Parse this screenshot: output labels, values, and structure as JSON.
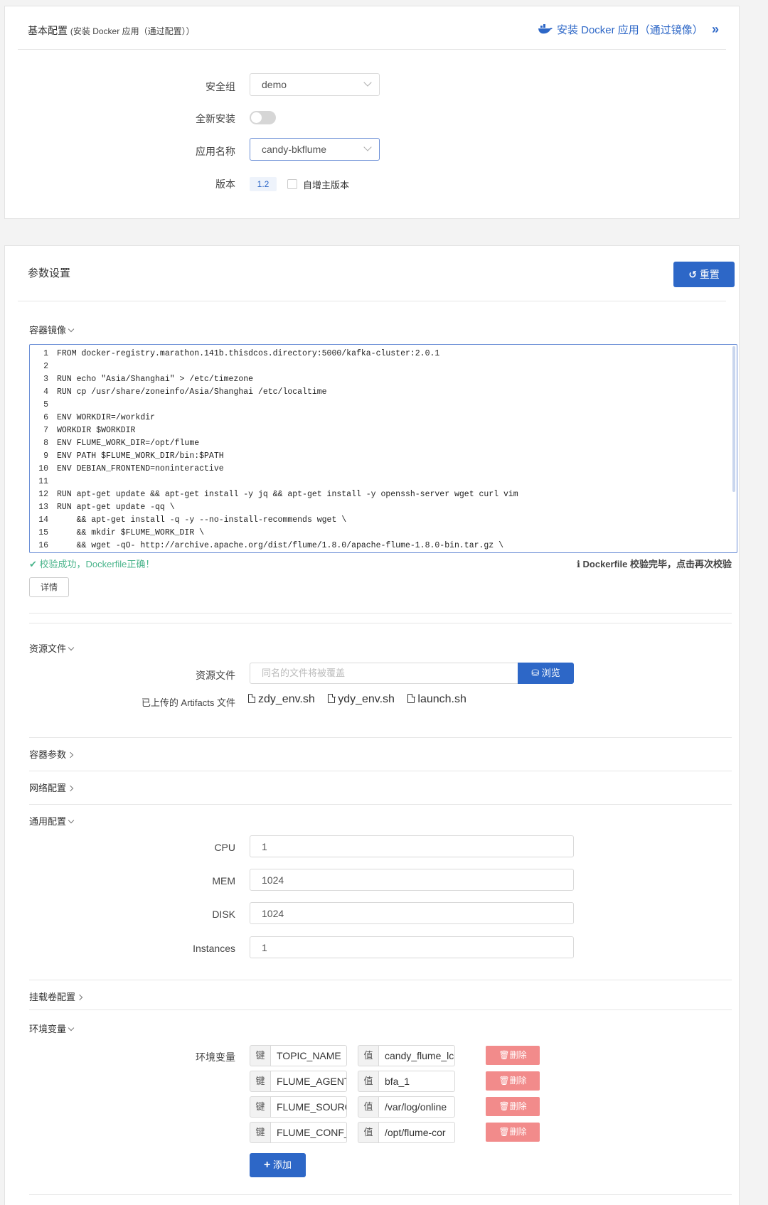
{
  "basic": {
    "title": "基本配置",
    "subtitle": "(安装 Docker 应用（通过配置））",
    "install_link": "安装 Docker 应用（通过镜像）",
    "install_arrow": "»",
    "security_group_label": "安全组",
    "security_group_value": "demo",
    "fresh_install_label": "全新安装",
    "fresh_install_on": false,
    "app_name_label": "应用名称",
    "app_name_value": "candy-bkflume",
    "version_label": "版本",
    "version_value": "1.2",
    "auto_increment_label": "自增主版本"
  },
  "params": {
    "title": "参数设置",
    "reset_label": "重置",
    "image_section": "容器镜像",
    "code_lines": [
      {
        "n": "1",
        "text": "FROM docker-registry.marathon.141b.thisdcos.directory:5000/kafka-cluster:2.0.1"
      },
      {
        "n": "2",
        "text": ""
      },
      {
        "n": "3",
        "text": "RUN echo \"Asia/Shanghai\" > /etc/timezone"
      },
      {
        "n": "4",
        "text": "RUN cp /usr/share/zoneinfo/Asia/Shanghai /etc/localtime"
      },
      {
        "n": "5",
        "text": ""
      },
      {
        "n": "6",
        "text": "ENV WORKDIR=/workdir"
      },
      {
        "n": "7",
        "text": "WORKDIR $WORKDIR"
      },
      {
        "n": "8",
        "text": "ENV FLUME_WORK_DIR=/opt/flume"
      },
      {
        "n": "9",
        "text": "ENV PATH $FLUME_WORK_DIR/bin:$PATH"
      },
      {
        "n": "10",
        "text": "ENV DEBIAN_FRONTEND=noninteractive"
      },
      {
        "n": "11",
        "text": ""
      },
      {
        "n": "12",
        "text": "RUN apt-get update && apt-get install -y jq && apt-get install -y openssh-server wget curl vim"
      },
      {
        "n": "13",
        "text": "RUN apt-get update -qq \\"
      },
      {
        "n": "14",
        "text": "    && apt-get install -q -y --no-install-recommends wget \\"
      },
      {
        "n": "15",
        "text": "    && mkdir $FLUME_WORK_DIR \\"
      },
      {
        "n": "16",
        "text": "    && wget -qO- http://archive.apache.org/dist/flume/1.8.0/apache-flume-1.8.0-bin.tar.gz \\"
      }
    ],
    "validate_success": "校验成功，Dockerfile正确！",
    "validate_hint": "Dockerfile 校验完毕，点击再次校验",
    "details_label": "详情",
    "resource_section": "资源文件",
    "resource_label": "资源文件",
    "resource_placeholder": "同名的文件将被覆盖",
    "browse_label": "浏览",
    "artifacts_label": "已上传的 Artifacts 文件",
    "artifacts": [
      "zdy_env.sh",
      "ydy_env.sh",
      "launch.sh"
    ],
    "container_params_section": "容器参数",
    "network_section": "网络配置",
    "general_section": "通用配置",
    "cpu_label": "CPU",
    "cpu_value": "1",
    "mem_label": "MEM",
    "mem_value": "1024",
    "disk_label": "DISK",
    "disk_value": "1024",
    "instances_label": "Instances",
    "instances_value": "1",
    "volume_section": "挂载卷配置",
    "env_section": "环境变量",
    "env_label": "环境变量",
    "key_tag": "键",
    "value_tag": "值",
    "env_vars": [
      {
        "key": "TOPIC_NAME",
        "value": "candy_flume_lc"
      },
      {
        "key": "FLUME_AGENT_",
        "value": "bfa_1"
      },
      {
        "key": "FLUME_SOURC",
        "value": "/var/log/online"
      },
      {
        "key": "FLUME_CONF_I",
        "value": "/opt/flume-cor"
      }
    ],
    "delete_label": "删除",
    "add_label": "添加"
  },
  "colors": {
    "primary": "#2d67c7",
    "success": "#4bb58c",
    "danger": "#f28b8b",
    "link": "#2d67c7"
  }
}
